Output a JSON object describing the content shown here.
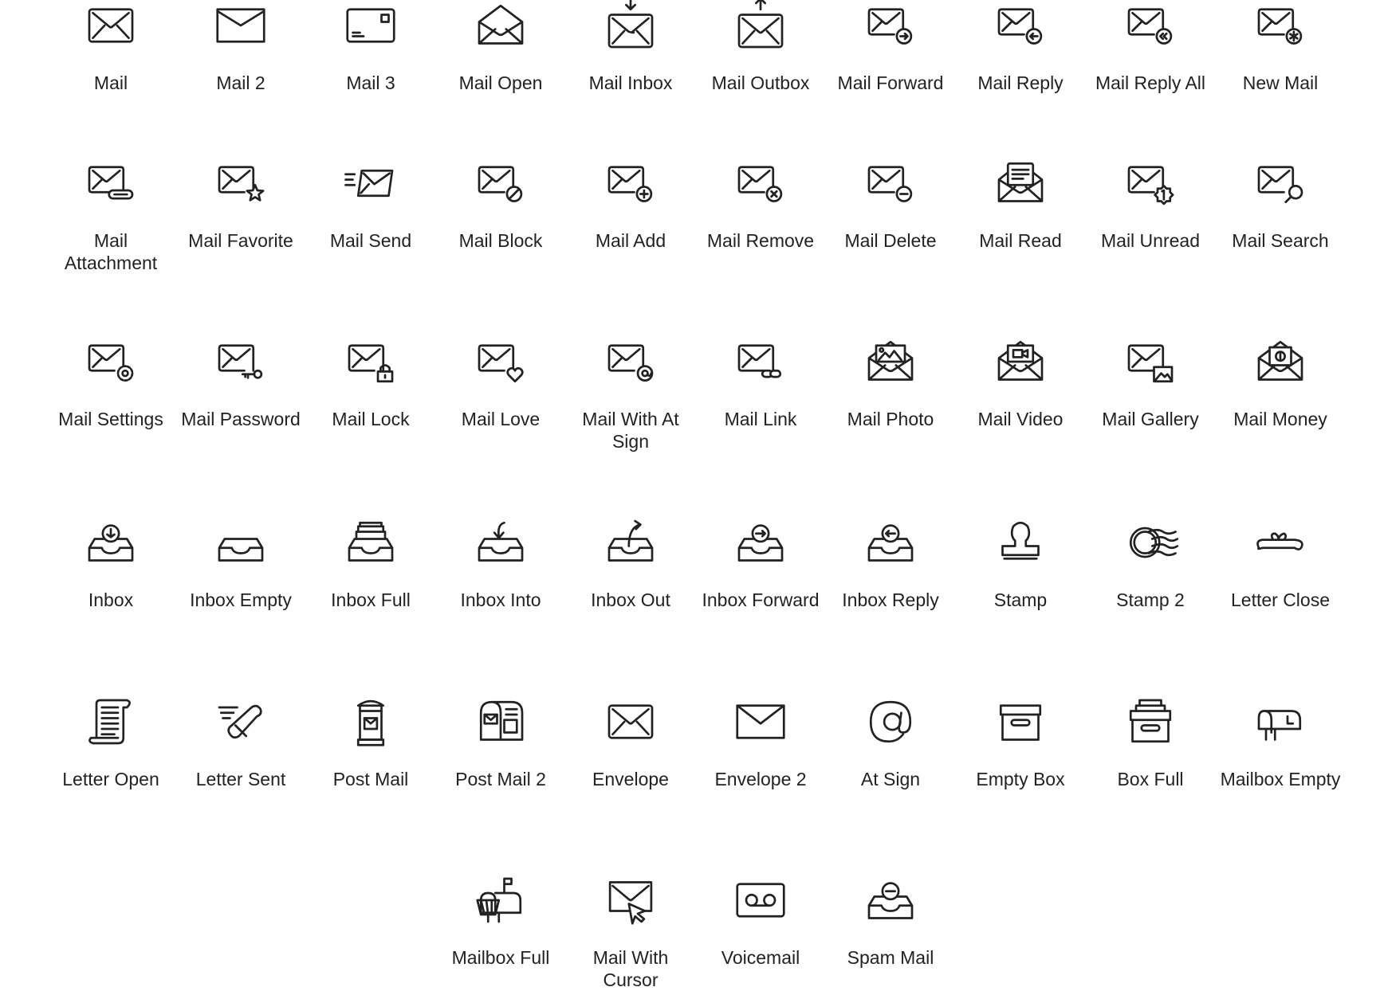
{
  "colors": {
    "icon_stroke": "#222222",
    "label": "#222222",
    "background": "#ffffff"
  },
  "rows": [
    [
      {
        "label": "Mail",
        "icon": "mail-icon"
      },
      {
        "label": "Mail 2",
        "icon": "mail-2-icon"
      },
      {
        "label": "Mail 3",
        "icon": "mail-3-icon"
      },
      {
        "label": "Mail Open",
        "icon": "mail-open-icon"
      },
      {
        "label": "Mail Inbox",
        "icon": "mail-inbox-icon"
      },
      {
        "label": "Mail Outbox",
        "icon": "mail-outbox-icon"
      },
      {
        "label": "Mail Forward",
        "icon": "mail-forward-icon"
      },
      {
        "label": "Mail Reply",
        "icon": "mail-reply-icon"
      },
      {
        "label": "Mail Reply All",
        "icon": "mail-reply-all-icon"
      },
      {
        "label": "New Mail",
        "icon": "new-mail-icon"
      }
    ],
    [
      {
        "label": "Mail Attachment",
        "icon": "mail-attachment-icon"
      },
      {
        "label": "Mail Favorite",
        "icon": "mail-favorite-icon"
      },
      {
        "label": "Mail Send",
        "icon": "mail-send-icon"
      },
      {
        "label": "Mail Block",
        "icon": "mail-block-icon"
      },
      {
        "label": "Mail Add",
        "icon": "mail-add-icon"
      },
      {
        "label": "Mail Remove",
        "icon": "mail-remove-icon"
      },
      {
        "label": "Mail Delete",
        "icon": "mail-delete-icon"
      },
      {
        "label": "Mail Read",
        "icon": "mail-read-icon"
      },
      {
        "label": "Mail Unread",
        "icon": "mail-unread-icon"
      },
      {
        "label": "Mail Search",
        "icon": "mail-search-icon"
      }
    ],
    [
      {
        "label": "Mail Settings",
        "icon": "mail-settings-icon"
      },
      {
        "label": "Mail Password",
        "icon": "mail-password-icon"
      },
      {
        "label": "Mail Lock",
        "icon": "mail-lock-icon"
      },
      {
        "label": "Mail Love",
        "icon": "mail-love-icon"
      },
      {
        "label": "Mail With At Sign",
        "icon": "mail-at-sign-icon"
      },
      {
        "label": "Mail Link",
        "icon": "mail-link-icon"
      },
      {
        "label": "Mail Photo",
        "icon": "mail-photo-icon"
      },
      {
        "label": "Mail Video",
        "icon": "mail-video-icon"
      },
      {
        "label": "Mail Gallery",
        "icon": "mail-gallery-icon"
      },
      {
        "label": "Mail Money",
        "icon": "mail-money-icon"
      }
    ],
    [
      {
        "label": "Inbox",
        "icon": "inbox-icon"
      },
      {
        "label": "Inbox Empty",
        "icon": "inbox-empty-icon"
      },
      {
        "label": "Inbox Full",
        "icon": "inbox-full-icon"
      },
      {
        "label": "Inbox Into",
        "icon": "inbox-into-icon"
      },
      {
        "label": "Inbox Out",
        "icon": "inbox-out-icon"
      },
      {
        "label": "Inbox Forward",
        "icon": "inbox-forward-icon"
      },
      {
        "label": "Inbox Reply",
        "icon": "inbox-reply-icon"
      },
      {
        "label": "Stamp",
        "icon": "stamp-icon"
      },
      {
        "label": "Stamp 2",
        "icon": "stamp-2-icon"
      },
      {
        "label": "Letter Close",
        "icon": "letter-close-icon"
      }
    ],
    [
      {
        "label": "Letter Open",
        "icon": "letter-open-icon"
      },
      {
        "label": "Letter Sent",
        "icon": "letter-sent-icon"
      },
      {
        "label": "Post Mail",
        "icon": "post-mail-icon"
      },
      {
        "label": "Post Mail 2",
        "icon": "post-mail-2-icon"
      },
      {
        "label": "Envelope",
        "icon": "envelope-icon"
      },
      {
        "label": "Envelope 2",
        "icon": "envelope-2-icon"
      },
      {
        "label": "At Sign",
        "icon": "at-sign-icon"
      },
      {
        "label": "Empty Box",
        "icon": "empty-box-icon"
      },
      {
        "label": "Box Full",
        "icon": "box-full-icon"
      },
      {
        "label": "Mailbox Empty",
        "icon": "mailbox-empty-icon"
      }
    ],
    [
      {
        "label": "Mailbox Full",
        "icon": "mailbox-full-icon"
      },
      {
        "label": "Mail With Cursor",
        "icon": "mail-cursor-icon"
      },
      {
        "label": "Voicemail",
        "icon": "voicemail-icon"
      },
      {
        "label": "Spam Mail",
        "icon": "spam-mail-icon"
      }
    ]
  ]
}
